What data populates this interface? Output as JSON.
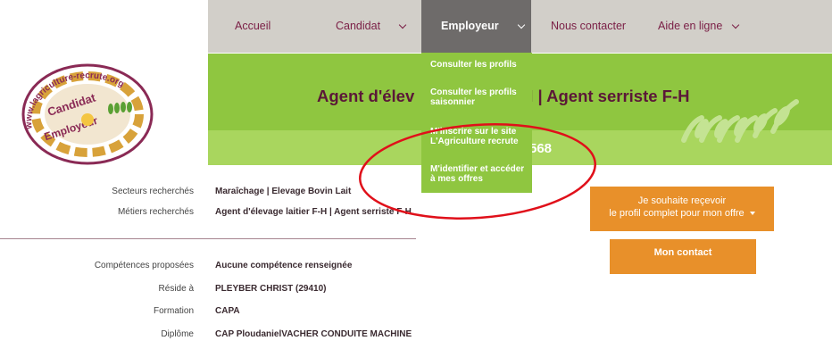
{
  "nav": {
    "items": [
      {
        "label": "Accueil"
      },
      {
        "label": "Candidat"
      },
      {
        "label": "Employeur"
      },
      {
        "label": "Nous contacter"
      },
      {
        "label": "Aide en ligne"
      }
    ]
  },
  "logo": {
    "ring_text": "www.lagriculture-recrute.org",
    "center_line1": "Candidat",
    "center_line2": "Employeur"
  },
  "banner": {
    "title_part1": "Agent d'élev",
    "title_part2": "H | Agent serriste F-H",
    "reference": "568"
  },
  "dropdown": {
    "items": [
      "Consulter les profils",
      "Consulter les profils saisonnier",
      "M'inscrire sur le site L'Agriculture recrute",
      "M'identifier et accéder à mes offres"
    ]
  },
  "details": {
    "rows_top": [
      {
        "label": "Secteurs recherchés",
        "value": "Maraîchage | Elevage Bovin Lait"
      },
      {
        "label": "Métiers recherchés",
        "value": "Agent d'élevage laitier F-H | Agent serriste F-H"
      }
    ],
    "rows_bottom": [
      {
        "label": "Compétences proposées",
        "value": "Aucune compétence renseignée"
      },
      {
        "label": "Réside à",
        "value": "PLEYBER CHRIST (29410)"
      },
      {
        "label": "Formation",
        "value": "CAPA"
      },
      {
        "label": "Diplôme",
        "value": "CAP PloudanielVACHER CONDUITE MACHINE"
      }
    ]
  },
  "buttons": {
    "profile_line1": "Je souhaite reçevoir",
    "profile_line2": "le profil complet pour mon offre",
    "contact": "Mon contact"
  },
  "colors": {
    "nav_bg": "#d2cfc9",
    "nav_active_bg": "#6e6b6a",
    "banner_green": "#8fc640",
    "brand_text": "#7a1e45",
    "orange": "#e8902a",
    "annotation_red": "#e0101a"
  },
  "icons": [
    "chevron-down-icon",
    "caret-down-icon",
    "leaves-decoration"
  ]
}
